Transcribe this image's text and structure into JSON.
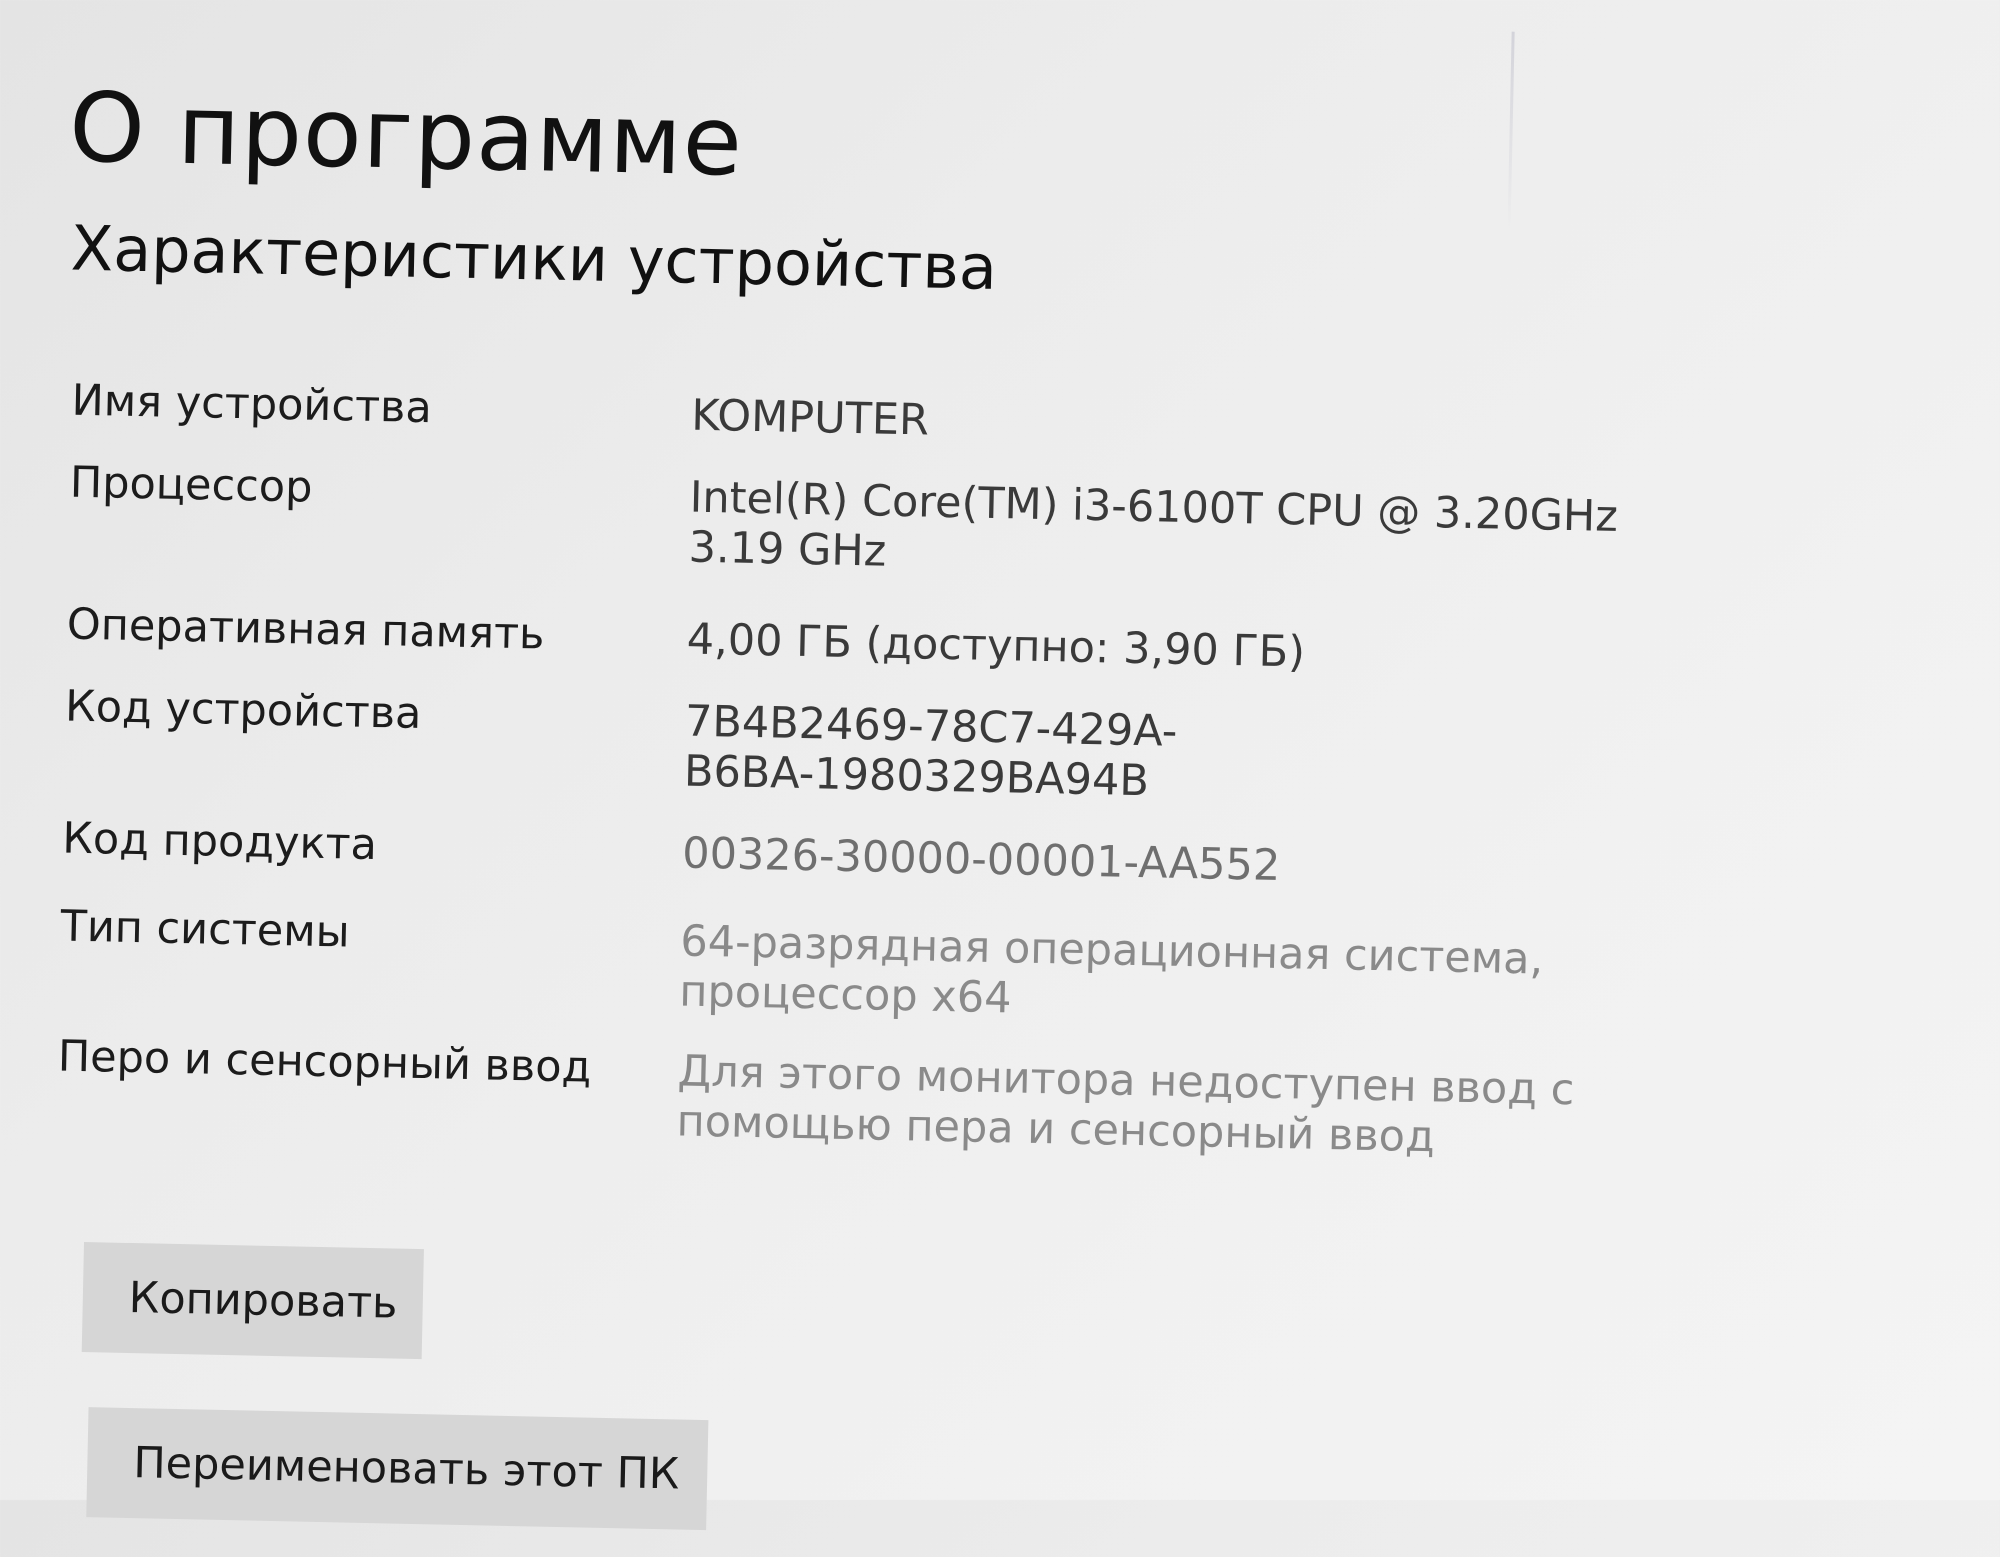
{
  "header": {
    "title": "О программе",
    "section_title": "Характеристики устройства"
  },
  "specs": [
    {
      "label": "Имя устройства",
      "value": "KOMPUTER"
    },
    {
      "label": "Процессор",
      "value_lines": [
        "Intel(R) Core(TM) i3-6100T CPU @ 3.20GHz",
        "3.19 GHz"
      ]
    },
    {
      "label": "Оперативная память",
      "value": "4,00 ГБ (доступно: 3,90 ГБ)"
    },
    {
      "label": "Код устройства",
      "value_lines": [
        "7B4B2469-78C7-429A-",
        "B6BA-1980329BA94B"
      ]
    },
    {
      "label": "Код продукта",
      "value": "00326-30000-00001-AA552"
    },
    {
      "label": "Тип системы",
      "value_lines": [
        "64-разрядная операционная система,",
        "процессор x64"
      ]
    },
    {
      "label": "Перо и сенсорный ввод",
      "value_lines": [
        "Для этого монитора недоступен ввод с",
        "помощью пера и сенсорный ввод"
      ]
    }
  ],
  "buttons": {
    "copy_label": "Копировать",
    "rename_label": "Переименовать этот ПК"
  }
}
